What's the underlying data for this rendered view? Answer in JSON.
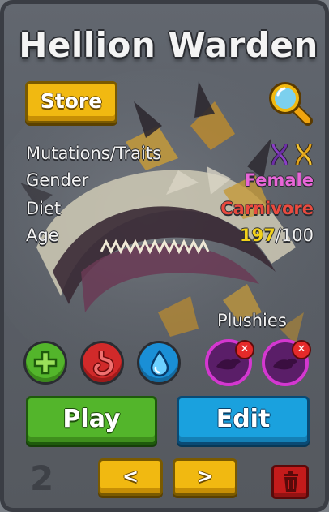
{
  "creature": {
    "name": "Hellion Warden"
  },
  "store_button": {
    "label": "Store"
  },
  "stats": {
    "mutations_label": "Mutations/Traits",
    "gender_label": "Gender",
    "gender_value": "Female",
    "diet_label": "Diet",
    "diet_value": "Carnivore",
    "age_label": "Age",
    "age_current": "197",
    "age_max": "/100"
  },
  "plushies": {
    "label": "Plushies"
  },
  "actions": {
    "play_label": "Play",
    "edit_label": "Edit"
  },
  "pagination": {
    "page": "2",
    "prev_label": "<",
    "next_label": ">"
  },
  "colors": {
    "gender": "#e866d8",
    "diet": "#ea4a3e",
    "age_current": "#f2d11a",
    "play": "#53b52b",
    "edit": "#1aa1de",
    "store": "#f1b911"
  },
  "icons": {
    "search": "magnifier-icon",
    "mutation": "dna-icon",
    "heal": "plus-icon",
    "food": "stomach-icon",
    "water": "water-drop-icon",
    "plush": "plush-icon",
    "remove": "close-icon",
    "delete": "trash-icon"
  }
}
